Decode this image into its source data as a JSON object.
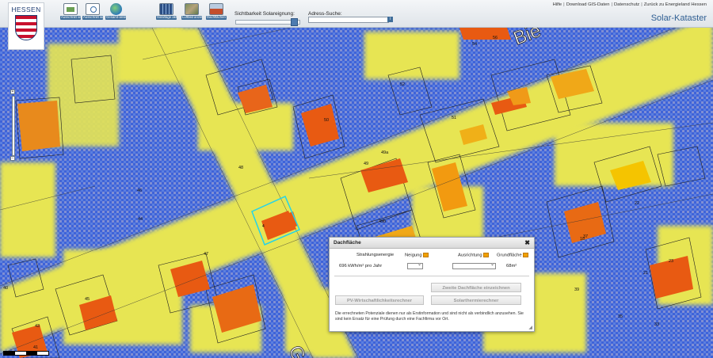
{
  "header": {
    "logo": {
      "word": "HESSEN"
    },
    "toolbar": [
      {
        "icon": "print-icon",
        "label": "Ausschnitt verschieben"
      },
      {
        "icon": "zoom-fit-icon",
        "label": "Ausschnitt wählen"
      },
      {
        "icon": "globe-icon",
        "label": "Gesamt-ansicht"
      },
      {
        "icon": "solar-panel-icon",
        "label": "Solarlage aktualisieren"
      },
      {
        "icon": "aerial-photo-icon",
        "label": "Luftbild anzeigen"
      },
      {
        "icon": "roof-icon",
        "label": "Dachflächen anzeigen"
      }
    ],
    "visibility_label": "Sichtbarkeit Solareignung:",
    "visibility_value": 0.92,
    "address_label": "Adress-Suche:",
    "address_value": "",
    "address_go": "i",
    "links": [
      "Hilfe",
      "Download GIS-Daten",
      "Datenschutz",
      "Zurück zu Energieland Hessen"
    ],
    "title": "Solar-Kataster"
  },
  "map": {
    "street_labels": [
      "Bie",
      "Ga"
    ],
    "house_numbers": [
      "54",
      "56",
      "48",
      "52",
      "50",
      "51",
      "49",
      "49a",
      "49b",
      "46",
      "44",
      "47",
      "45",
      "43",
      "41",
      "40",
      "39",
      "37",
      "35",
      "33",
      "22",
      "21",
      "23",
      "18"
    ],
    "selected_marker": "4",
    "zoom_in": "+",
    "zoom_out": "−",
    "colors": {
      "high": "#e85a12",
      "medium": "#f5c400",
      "low": "#e7e553",
      "shade": "#3f63d8",
      "selection": "#25d3e8"
    }
  },
  "panel": {
    "title": "Dachfläche",
    "close": "✖",
    "headers": {
      "energy": "Strahlungsenergie",
      "slope": "Neigung",
      "orientation": "Ausrichtung",
      "area": "Grundfläche"
    },
    "energy_value": "696 kWh/m² pro Jahr",
    "slope_value": "",
    "orientation_value": "",
    "area_value": "68m²",
    "btn_second_roof": "Zweite Dachfläche einzeichnen",
    "btn_pv": "PV-Wirtschaftlichkeitsrechner",
    "btn_solarthermal": "Solarthermierechner",
    "disclaimer": "Die errechneten Potenziale dienen nur als Erstinformation und sind nicht als verbindlich anzusehen. Sie sind kein Ersatz für eine Prüfung durch eine Fachfirma vor Ort."
  }
}
